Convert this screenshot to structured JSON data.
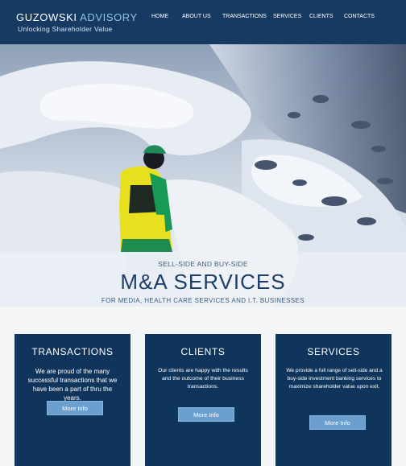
{
  "header": {
    "brand_primary": "GUZOWSKI",
    "brand_accent": "ADVISORY",
    "tagline": "Unlocking Shareholder Value",
    "nav": [
      "HOME",
      "ABOUT US",
      "TRANSACTIONS",
      "SERVICES",
      "CLIENTS",
      "CONTACTS"
    ]
  },
  "hero": {
    "kicker": "SELL-SIDE AND BUY-SIDE",
    "title": "M&A SERVICES",
    "subtitle": "FOR MEDIA, HEALTH CARE SERVICES AND I.T. BUSINESSES"
  },
  "cards": [
    {
      "title": "TRANSACTIONS",
      "text": "We are proud of the many successful transactions that we have been a part of thru the years.",
      "button": "More Info"
    },
    {
      "title": "CLIENTS",
      "text": "Our clients are happy with the results and the outcome of their business transactions.",
      "button": "More Info"
    },
    {
      "title": "SERVICES",
      "text": "We provide a full range of sell-side and a buy-side investment banking services to maximize shareholder value upon exit.",
      "button": "More Info"
    }
  ],
  "colors": {
    "header_bg": "#173a63",
    "brand_accent": "#8fc4ea",
    "card_bg": "#0f355c",
    "button_bg": "#6b9fd0",
    "hero_title": "#1c3e69"
  }
}
